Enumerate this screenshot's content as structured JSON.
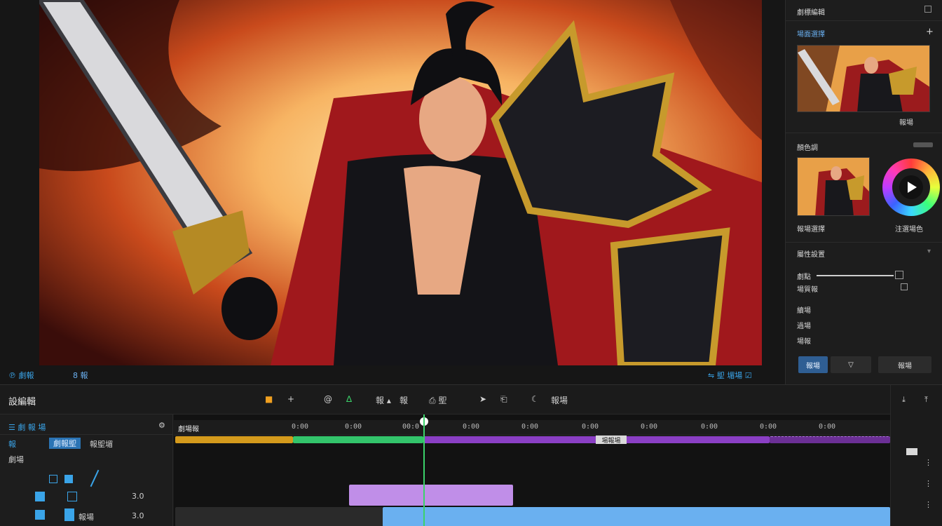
{
  "viewer": {
    "status_left": "℗ 劇報",
    "status_badge": "8 報",
    "status_right": "⇋ 堲 堳場 ☑"
  },
  "right_panel": {
    "header_title": "劇標編輯",
    "source_label": "場面選擇",
    "source_plus": "+",
    "thumb_caption": "報場",
    "color_label": "顏色調",
    "color_thumb_caption": "報場選擇",
    "color_wheel_caption": "注選場色",
    "props_label": "屬性設置",
    "row1_label": "劇點",
    "row2_label": "場質報",
    "row3_label": "續場",
    "row4_label": "過場",
    "row5_label": "場報",
    "btn_apply": "報場",
    "btn_flag": "▽",
    "btn_reset": "報場"
  },
  "timeline": {
    "title": "設編輯",
    "tools": [
      "■",
      "+",
      "@",
      "∆",
      "報 ▴",
      "報",
      "⎙ 堲",
      "➤",
      "⎗",
      "☾",
      "報場"
    ],
    "ruler_labels": [
      "0:00",
      "0:00",
      "00:0",
      "0:00",
      "0:00",
      "0:00",
      "0:00",
      "0:00",
      "0:00",
      "0:00"
    ],
    "track_label": "劇場報",
    "marker_label": "場報場",
    "headers": {
      "row1": "☰ 劇 報 場",
      "row2a": "報",
      "row2b": "劇報堲",
      "row2c": "報堲堳",
      "row3": "劇場",
      "val1": "3.0",
      "val2": "3.0",
      "row5": "報場"
    }
  },
  "colors": {
    "accent_blue": "#3aa4e8",
    "clip_orange": "#d49a1c",
    "clip_green": "#33c46b",
    "clip_purple": "#8a3fc4",
    "clip_violet": "#c08ee8",
    "clip_blue": "#6ab0f0",
    "playhead": "#3bd26a"
  }
}
